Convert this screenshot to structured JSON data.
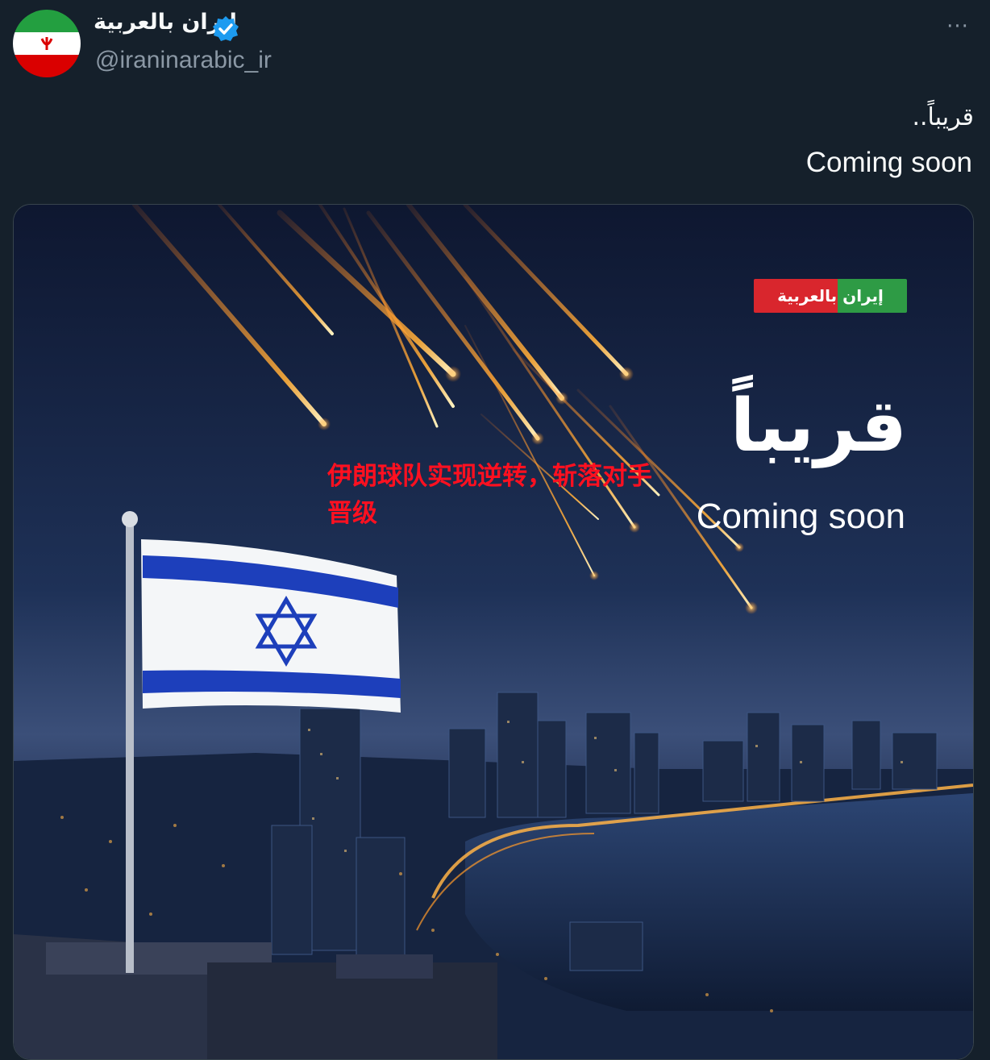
{
  "post": {
    "display_name": "إيران بالعربية",
    "handle": "@iraninarabic_ir",
    "more_label": "···",
    "text_ar": "قريباً..",
    "text_en": "Coming soon"
  },
  "media": {
    "logo_text": "إيران بالعربية",
    "headline_ar": "قريباً",
    "headline_en": "Coming soon"
  },
  "overlay": {
    "caption": "伊朗球队实现逆转，斩落对手晋级"
  },
  "colors": {
    "background": "#15202b",
    "verified_badge": "#1d9bf0",
    "handle_text": "#8b98a5",
    "overlay_caption": "#ff1020"
  },
  "icons": {
    "verified": "verified-badge-icon",
    "more": "more-options-icon"
  }
}
